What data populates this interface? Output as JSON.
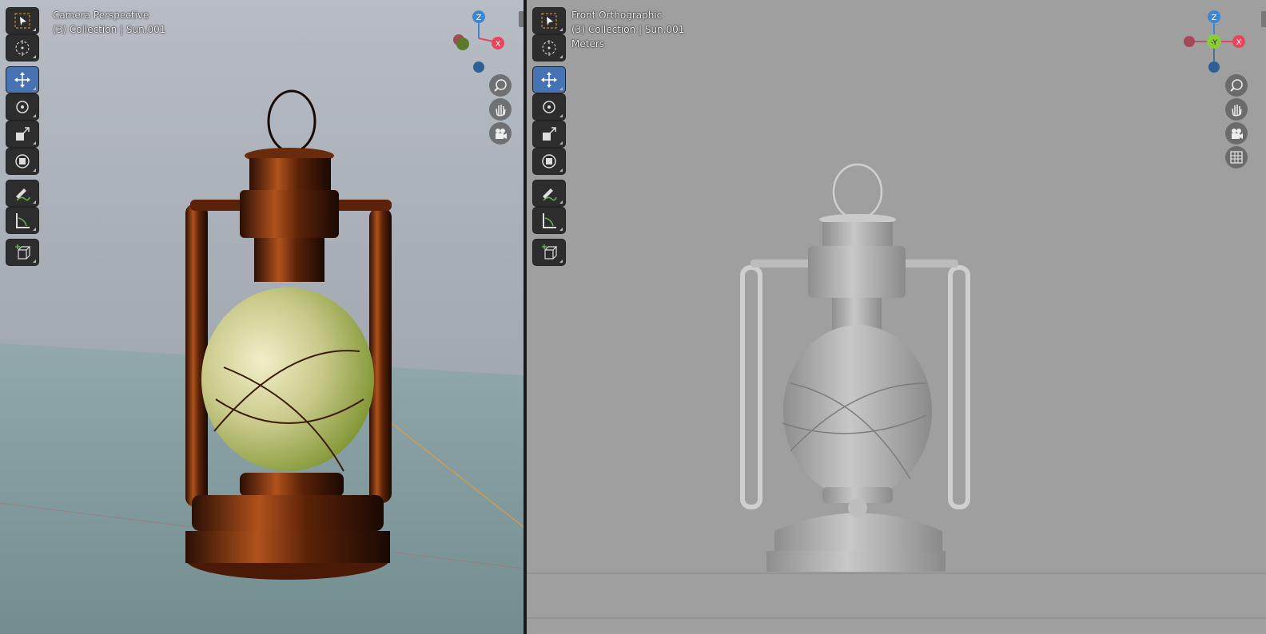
{
  "left_viewport": {
    "view_name": "Camera Perspective",
    "collection_info": "(3) Collection | Sun.001"
  },
  "right_viewport": {
    "view_name": "Front Orthographic",
    "collection_info": "(3) Collection | Sun.001",
    "units": "Meters"
  },
  "gizmo_labels": {
    "z": "Z",
    "x": "X",
    "y": "-Y"
  },
  "tools": [
    "select-box",
    "cursor",
    "move",
    "rotate",
    "scale",
    "transform",
    "annotate",
    "measure",
    "add-cube"
  ],
  "active_tool": "move",
  "colors": {
    "x_axis": "#e8455c",
    "y_axis": "#8bcb3a",
    "z_axis": "#3b86d6",
    "active_tool": "#4772b3",
    "copper": "#8a3c12",
    "clay": "#b9b9b9"
  }
}
